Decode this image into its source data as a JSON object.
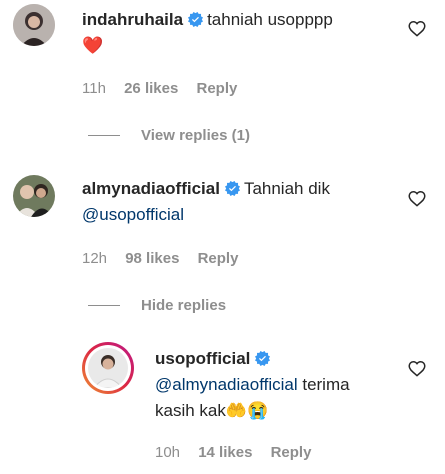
{
  "comments": [
    {
      "username": "indahruhaila",
      "text": "tahniah usopppp",
      "emoji_line": "❤️",
      "time": "11h",
      "likes": "26 likes",
      "reply_label": "Reply",
      "replies_toggle": "View replies (1)"
    },
    {
      "username": "almynadiaofficial",
      "text": "Tahniah dik",
      "mention": "@usopofficial",
      "time": "12h",
      "likes": "98 likes",
      "reply_label": "Reply",
      "replies_toggle": "Hide replies"
    }
  ],
  "reply": {
    "username": "usopofficial",
    "mention": "@almynadiaofficial",
    "text_after_mention": " terima",
    "text_line2": "kasih kak",
    "emojis": "🤲😭",
    "time": "10h",
    "likes": "14 likes",
    "reply_label": "Reply"
  },
  "colors": {
    "verified": "#3897f0",
    "heart": "#ed4956",
    "mention": "#00376b",
    "story_ring_start": "#f09433",
    "story_ring_end": "#bc1888"
  },
  "icons": {
    "like": "heart-outline-icon",
    "verified": "verified-badge-icon"
  }
}
